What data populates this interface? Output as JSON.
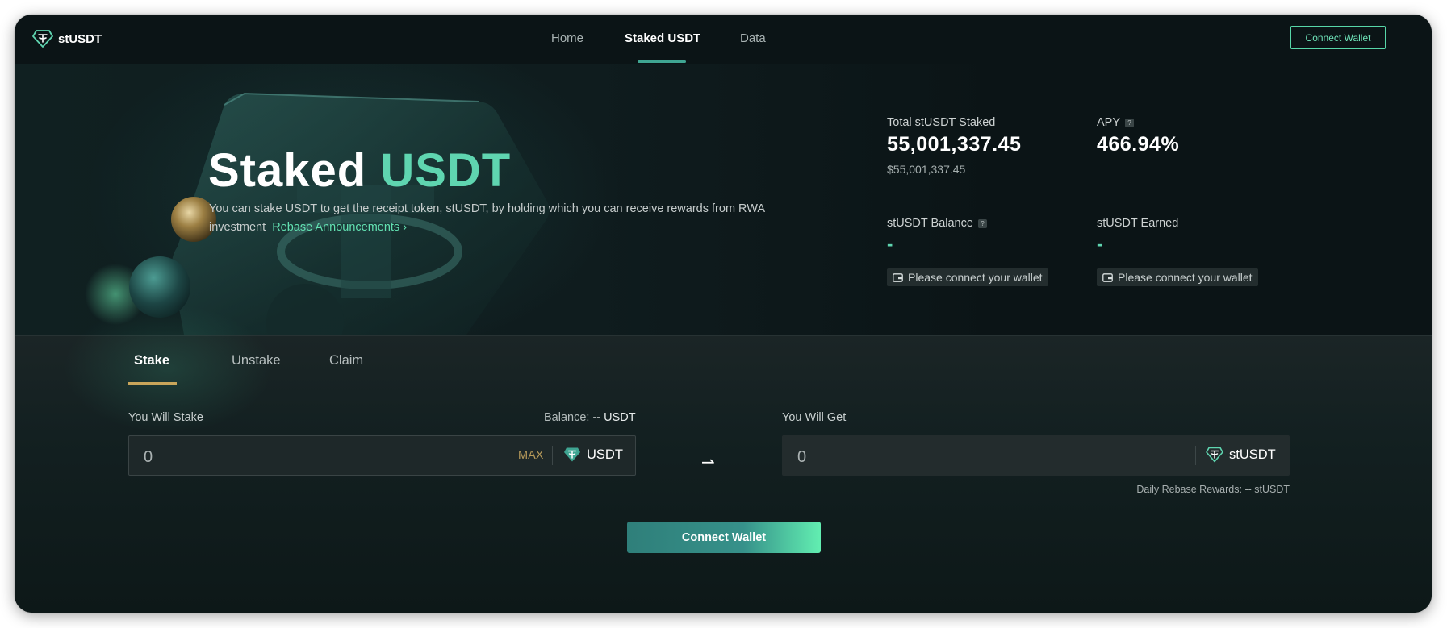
{
  "app": {
    "name": "stUSDT"
  },
  "nav": {
    "links": [
      {
        "label": "Home"
      },
      {
        "label": "Staked USDT"
      },
      {
        "label": "Data"
      }
    ],
    "connect_label": "Connect Wallet"
  },
  "hero": {
    "title_part1": "Staked",
    "title_part2": "USDT",
    "description": "You can stake USDT to get the receipt token, stUSDT, by holding which you can receive rewards from RWA investment",
    "link_label": "Rebase Announcements",
    "link_chevron": "›"
  },
  "stats": {
    "total_staked_label": "Total stUSDT Staked",
    "total_staked_value": "55,001,337.45",
    "total_staked_usd": "$55,001,337.45",
    "apy_label": "APY",
    "apy_value": "466.94%",
    "balance_label": "stUSDT Balance",
    "balance_value": "-",
    "earned_label": "stUSDT Earned",
    "earned_value": "-",
    "wallet_prompt": "Please connect your wallet",
    "help_glyph": "?"
  },
  "tabs": [
    {
      "label": "Stake"
    },
    {
      "label": "Unstake"
    },
    {
      "label": "Claim"
    }
  ],
  "stake_form": {
    "stake_label": "You Will Stake",
    "balance_label": "Balance:",
    "balance_value": "-- USDT",
    "stake_placeholder": "0",
    "max_label": "MAX",
    "stake_token": "USDT",
    "get_label": "You Will Get",
    "get_placeholder": "0",
    "get_token": "stUSDT",
    "arrow_glyph": "⇀",
    "rebase_note": "Daily Rebase Rewards: -- stUSDT",
    "submit_label": "Connect Wallet"
  },
  "colors": {
    "accent": "#5fd5b0",
    "background": "#0c1516",
    "max_gold": "#b79a5a"
  },
  "icons": {
    "logo": "tether-diamond-icon",
    "help": "question-icon",
    "wallet": "wallet-icon"
  }
}
